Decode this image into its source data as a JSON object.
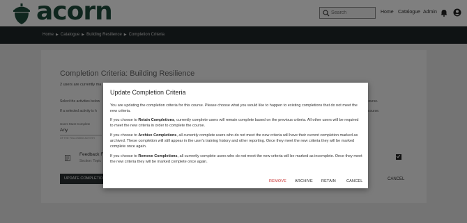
{
  "brand": {
    "name": "acorn",
    "color": "#1e4c3c"
  },
  "header": {
    "search_placeholder": "Search",
    "nav": [
      "Home",
      "Catalogue",
      "Admin"
    ]
  },
  "breadcrumb": [
    "Home",
    "Catalogue",
    "Building Resilience",
    "Completion Criteria"
  ],
  "page": {
    "title": "Completion Criteria: Building Resilience",
    "users_text": "2 users are currently ma",
    "select_text": "Select the activities below",
    "selected_text": "If a selected activity is h",
    "right_text_1": "course.",
    "right_text_2": "he course.",
    "users_must_label": "Users Must Complete",
    "users_must_value": "Any",
    "following_caption": "OF THE FOLLOWING ACTIVITI",
    "activity_title": "Feedback F",
    "activity_sub": "Section: Topic",
    "update_button": "UPDATE COMPLETION",
    "cancel_button": "CANCEL"
  },
  "dialog": {
    "title": "Update Completion Criteria",
    "intro": "You are updating the completion criteria for this course. Please choose what you would like to happen to existing completions that do not meet the new criteria.",
    "retain_prefix": "If you choose to ",
    "retain_bold": "Retain Completions",
    "retain_rest": ", currently complete users will remain complete based on the previous criteria. All other users will be required to meet the new criteria in order to complete the course.",
    "archive_prefix": "If you choose to ",
    "archive_bold": "Archive Completions",
    "archive_rest": ", all currently complete users who do not meet the new criteria will have their current completion marked as archived. These completion will still appear in the user's training history and other reporting. Once they meet the new criteria they will be marked complete once again.",
    "remove_prefix": "If you choose to ",
    "remove_bold": "Remove Completions",
    "remove_rest": ", all currently complete users who do not meet the new criteria will be marked as incomplete. Once they meet the new criteria they will be marked complete once again.",
    "buttons": {
      "remove": "REMOVE",
      "archive": "ARCHIVE",
      "retain": "RETAIN",
      "cancel": "CANCEL"
    },
    "remove_color": "#c62828"
  }
}
